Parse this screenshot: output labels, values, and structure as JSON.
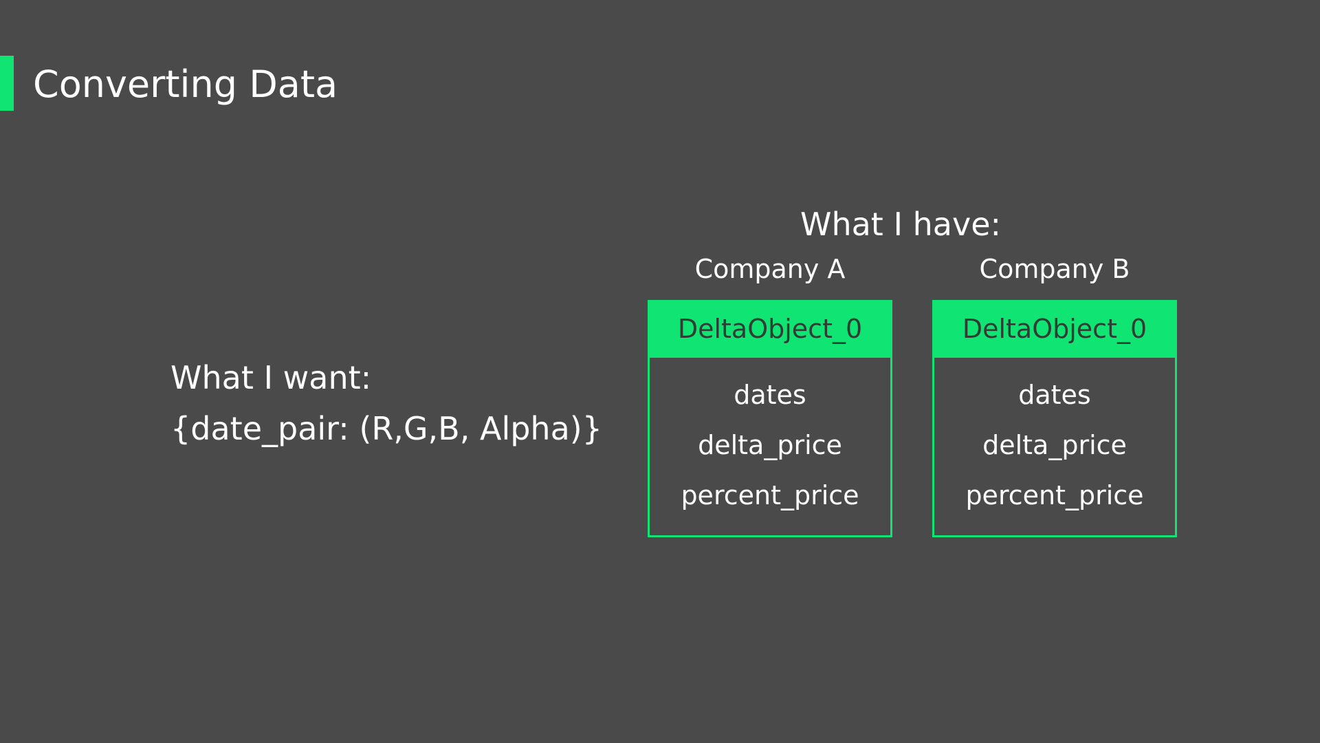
{
  "slide": {
    "title": "Converting Data",
    "accent_color": "#10e472",
    "background_color": "#4a4a4a"
  },
  "want": {
    "heading": "What I want:",
    "expression": "{date_pair: (R,G,B, Alpha)}"
  },
  "have": {
    "heading": "What I have:",
    "companies": [
      {
        "label": "Company A",
        "object_name": "DeltaObject_0",
        "fields": [
          "dates",
          "delta_price",
          "percent_price"
        ]
      },
      {
        "label": "Company B",
        "object_name": "DeltaObject_0",
        "fields": [
          "dates",
          "delta_price",
          "percent_price"
        ]
      }
    ]
  }
}
